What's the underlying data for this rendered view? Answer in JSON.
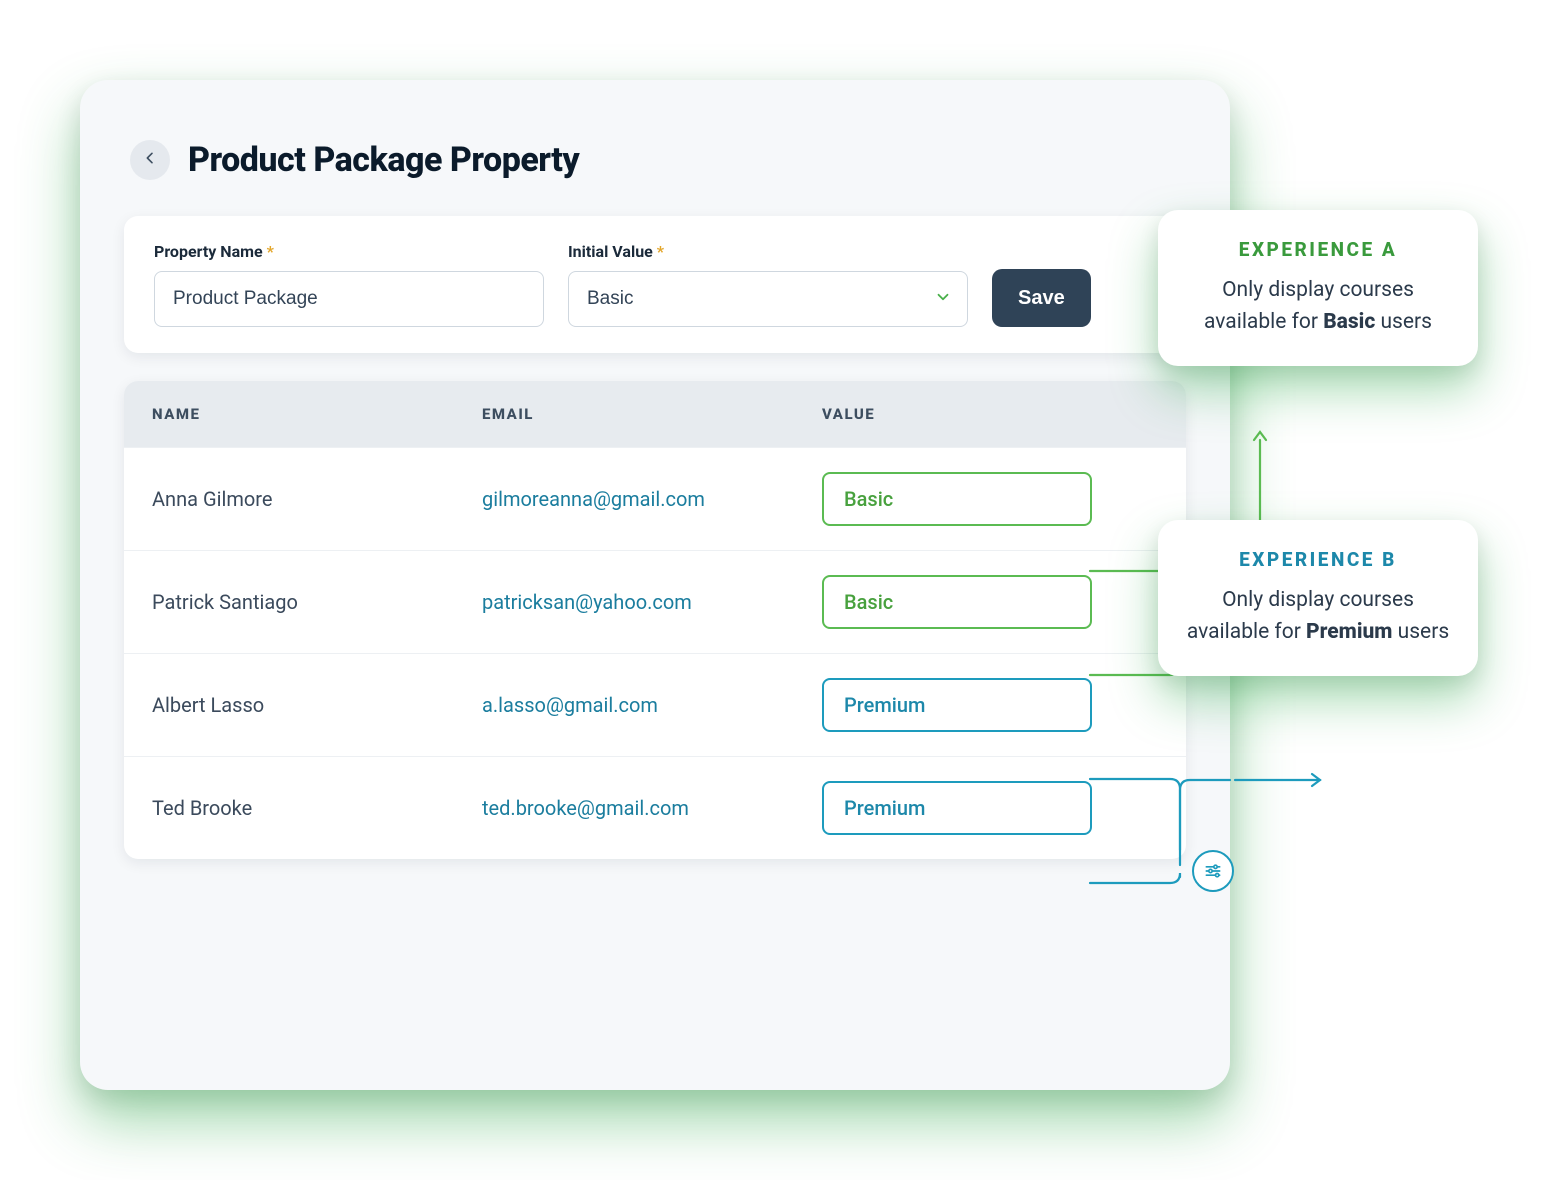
{
  "header": {
    "title": "Product Package Property"
  },
  "form": {
    "property_name_label": "Property Name",
    "property_name_value": "Product Package",
    "initial_value_label": "Initial Value",
    "initial_value_value": "Basic",
    "save_label": "Save"
  },
  "table": {
    "columns": {
      "name": "NAME",
      "email": "EMAIL",
      "value": "VALUE"
    },
    "rows": [
      {
        "name": "Anna Gilmore",
        "email": "gilmoreanna@gmail.com",
        "value": "Basic",
        "tier": "basic"
      },
      {
        "name": "Patrick Santiago",
        "email": "patricksan@yahoo.com",
        "value": "Basic",
        "tier": "basic"
      },
      {
        "name": "Albert Lasso",
        "email": "a.lasso@gmail.com",
        "value": "Premium",
        "tier": "premium"
      },
      {
        "name": "Ted Brooke",
        "email": "ted.brooke@gmail.com",
        "value": "Premium",
        "tier": "premium"
      }
    ]
  },
  "experiences": {
    "a": {
      "title": "EXPERIENCE A",
      "body_pre": "Only display courses available for ",
      "body_bold": "Basic",
      "body_post": " users"
    },
    "b": {
      "title": "EXPERIENCE B",
      "body_pre": "Only display courses available for ",
      "body_bold": "Premium",
      "body_post": " users"
    }
  },
  "colors": {
    "basic": "#5bbb52",
    "premium": "#1d9bbd",
    "save_bg": "#2f4357"
  }
}
